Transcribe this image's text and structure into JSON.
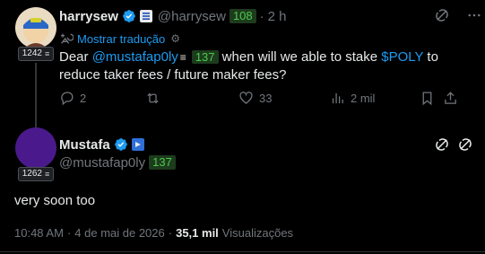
{
  "reply": {
    "author_name": "harrysew",
    "author_handle": "@harrysew",
    "author_score": "108",
    "separator": "·",
    "time": "2 h",
    "avatar_rep": "1242",
    "translate_label": "Mostrar tradução",
    "text": {
      "prefix": "Dear ",
      "mention": "@mustafap0ly",
      "mention_score": "137",
      "mid": " when will we able to stake ",
      "cashtag": "$POLY",
      "suffix": " to reduce taker fees / future maker fees?"
    },
    "actions": {
      "replies": "2",
      "reposts": "",
      "likes": "33",
      "views": "2 mil"
    }
  },
  "main": {
    "author_name": "Mustafa",
    "author_handle": "@mustafap0ly",
    "author_score": "137",
    "avatar_rep": "1262",
    "text": "very soon too",
    "time": "10:48 AM",
    "sep1": "·",
    "date": "4 de mai de 2026",
    "sep2": "·",
    "views_count": "35,1 mil",
    "views_label": "Visualizações"
  },
  "colors": {
    "accent": "#1d9bf0",
    "muted": "#71767b",
    "score_bg": "#1d3b1d",
    "score_fg": "#4ec94e",
    "avatar_main": "#4a1a8c"
  },
  "icons": [
    "verified-icon",
    "exchange-badge-icon",
    "translate-icon",
    "gear-icon",
    "grok-icon",
    "more-icon",
    "reply-icon",
    "repost-icon",
    "like-icon",
    "views-icon",
    "bookmark-icon",
    "share-icon",
    "follow-toggle-icon"
  ]
}
